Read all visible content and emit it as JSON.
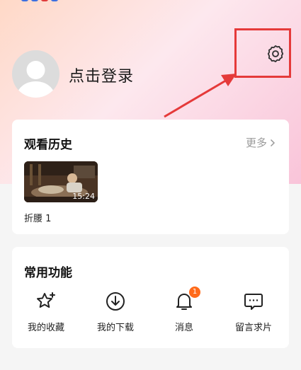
{
  "header": {
    "login_text": "点击登录",
    "settings_icon": "gear-icon",
    "accent_colors": {
      "highlight": "#e53a3a",
      "badge": "#ff6a1a"
    }
  },
  "history": {
    "title": "观看历史",
    "more_label": "更多",
    "items": [
      {
        "title": "折腰 1",
        "duration": "15:24"
      }
    ]
  },
  "functions": {
    "title": "常用功能",
    "items": [
      {
        "label": "我的收藏",
        "icon": "star-icon"
      },
      {
        "label": "我的下载",
        "icon": "download-icon"
      },
      {
        "label": "消息",
        "icon": "bell-icon",
        "badge": "1"
      },
      {
        "label": "留言求片",
        "icon": "message-icon"
      }
    ]
  }
}
